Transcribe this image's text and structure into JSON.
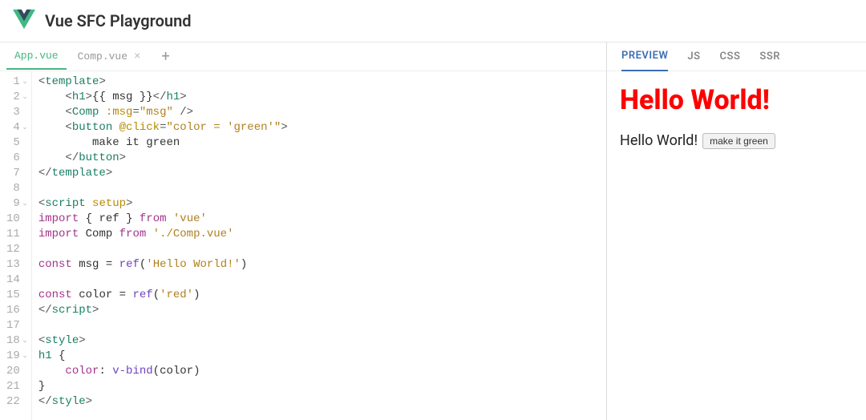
{
  "header": {
    "title": "Vue SFC Playground"
  },
  "fileTabs": {
    "items": [
      {
        "label": "App.vue",
        "active": true,
        "closable": false
      },
      {
        "label": "Comp.vue",
        "active": false,
        "closable": true
      }
    ],
    "addLabel": "+"
  },
  "code": {
    "lineCount": 22,
    "foldLines": [
      1,
      2,
      4,
      9,
      18,
      19
    ],
    "lines": [
      [
        [
          "t-pun",
          "<"
        ],
        [
          "t-tag",
          "template"
        ],
        [
          "t-pun",
          ">"
        ]
      ],
      [
        [
          "t-text",
          "    "
        ],
        [
          "t-pun",
          "<"
        ],
        [
          "t-tag",
          "h1"
        ],
        [
          "t-pun",
          ">"
        ],
        [
          "t-text",
          "{{ msg }}"
        ],
        [
          "t-pun",
          "</"
        ],
        [
          "t-tag",
          "h1"
        ],
        [
          "t-pun",
          ">"
        ]
      ],
      [
        [
          "t-text",
          "    "
        ],
        [
          "t-pun",
          "<"
        ],
        [
          "t-tag",
          "Comp"
        ],
        [
          "t-text",
          " "
        ],
        [
          "t-attr",
          ":msg"
        ],
        [
          "t-pun",
          "="
        ],
        [
          "t-str",
          "\"msg\""
        ],
        [
          "t-text",
          " "
        ],
        [
          "t-pun",
          "/>"
        ]
      ],
      [
        [
          "t-text",
          "    "
        ],
        [
          "t-pun",
          "<"
        ],
        [
          "t-tag",
          "button"
        ],
        [
          "t-text",
          " "
        ],
        [
          "t-attr",
          "@click"
        ],
        [
          "t-pun",
          "="
        ],
        [
          "t-str",
          "\"color = 'green'\""
        ],
        [
          "t-pun",
          ">"
        ]
      ],
      [
        [
          "t-text",
          "        make it green"
        ]
      ],
      [
        [
          "t-text",
          "    "
        ],
        [
          "t-pun",
          "</"
        ],
        [
          "t-tag",
          "button"
        ],
        [
          "t-pun",
          ">"
        ]
      ],
      [
        [
          "t-pun",
          "</"
        ],
        [
          "t-tag",
          "template"
        ],
        [
          "t-pun",
          ">"
        ]
      ],
      [],
      [
        [
          "t-pun",
          "<"
        ],
        [
          "t-tag",
          "script"
        ],
        [
          "t-text",
          " "
        ],
        [
          "t-attr",
          "setup"
        ],
        [
          "t-pun",
          ">"
        ]
      ],
      [
        [
          "t-kw",
          "import"
        ],
        [
          "t-text",
          " { "
        ],
        [
          "t-id",
          "ref"
        ],
        [
          "t-text",
          " } "
        ],
        [
          "t-kw",
          "from"
        ],
        [
          "t-text",
          " "
        ],
        [
          "t-str",
          "'vue'"
        ]
      ],
      [
        [
          "t-kw",
          "import"
        ],
        [
          "t-text",
          " "
        ],
        [
          "t-id",
          "Comp"
        ],
        [
          "t-text",
          " "
        ],
        [
          "t-kw",
          "from"
        ],
        [
          "t-text",
          " "
        ],
        [
          "t-str",
          "'./Comp.vue'"
        ]
      ],
      [],
      [
        [
          "t-kw",
          "const"
        ],
        [
          "t-text",
          " "
        ],
        [
          "t-id",
          "msg"
        ],
        [
          "t-text",
          " = "
        ],
        [
          "t-func",
          "ref"
        ],
        [
          "t-text",
          "("
        ],
        [
          "t-str",
          "'Hello World!'"
        ],
        [
          "t-text",
          ")"
        ]
      ],
      [],
      [
        [
          "t-kw",
          "const"
        ],
        [
          "t-text",
          " "
        ],
        [
          "t-id",
          "color"
        ],
        [
          "t-text",
          " = "
        ],
        [
          "t-func",
          "ref"
        ],
        [
          "t-text",
          "("
        ],
        [
          "t-str",
          "'red'"
        ],
        [
          "t-text",
          ")"
        ]
      ],
      [
        [
          "t-pun",
          "</"
        ],
        [
          "t-tag",
          "script"
        ],
        [
          "t-pun",
          ">"
        ]
      ],
      [],
      [
        [
          "t-pun",
          "<"
        ],
        [
          "t-tag",
          "style"
        ],
        [
          "t-pun",
          ">"
        ]
      ],
      [
        [
          "t-tag",
          "h1"
        ],
        [
          "t-text",
          " {"
        ]
      ],
      [
        [
          "t-text",
          "    "
        ],
        [
          "t-prop",
          "color"
        ],
        [
          "t-text",
          ": "
        ],
        [
          "t-func",
          "v-bind"
        ],
        [
          "t-text",
          "("
        ],
        [
          "t-id",
          "color"
        ],
        [
          "t-text",
          ")"
        ]
      ],
      [
        [
          "t-text",
          "}"
        ]
      ],
      [
        [
          "t-pun",
          "</"
        ],
        [
          "t-tag",
          "style"
        ],
        [
          "t-pun",
          ">"
        ]
      ]
    ]
  },
  "outputTabs": {
    "items": [
      {
        "label": "PREVIEW",
        "active": true
      },
      {
        "label": "JS",
        "active": false
      },
      {
        "label": "CSS",
        "active": false
      },
      {
        "label": "SSR",
        "active": false
      }
    ]
  },
  "preview": {
    "heading": "Hello World!",
    "msg": "Hello World!",
    "buttonLabel": "make it green",
    "headingColor": "red"
  }
}
